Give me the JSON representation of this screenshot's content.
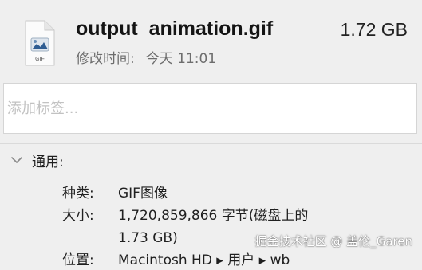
{
  "file": {
    "name": "output_animation.gif",
    "size": "1.72 GB",
    "modified_label": "修改时间:",
    "modified_value": "今天 11:01",
    "icon_badge": "GIF",
    "icon": "gif-file-icon"
  },
  "tags": {
    "placeholder": "添加标签..."
  },
  "general": {
    "title": "通用:",
    "chevron_icon": "chevron-down-icon",
    "kind_label": "种类:",
    "kind_value": "GIF图像",
    "size_label": "大小:",
    "size_value_line1": "1,720,859,866 字节(磁盘上的",
    "size_value_line2": "1.73 GB)",
    "where_label": "位置:",
    "where_value": "Macintosh HD ▸ 用户 ▸ wb"
  },
  "watermark": {
    "text": "掘金技术社区 @ 盖伦_Garen"
  },
  "colors": {
    "background": "#efefef",
    "field_background": "#ffffff",
    "secondary_text": "#6d6d6d",
    "placeholder_text": "#c2c2c2"
  }
}
